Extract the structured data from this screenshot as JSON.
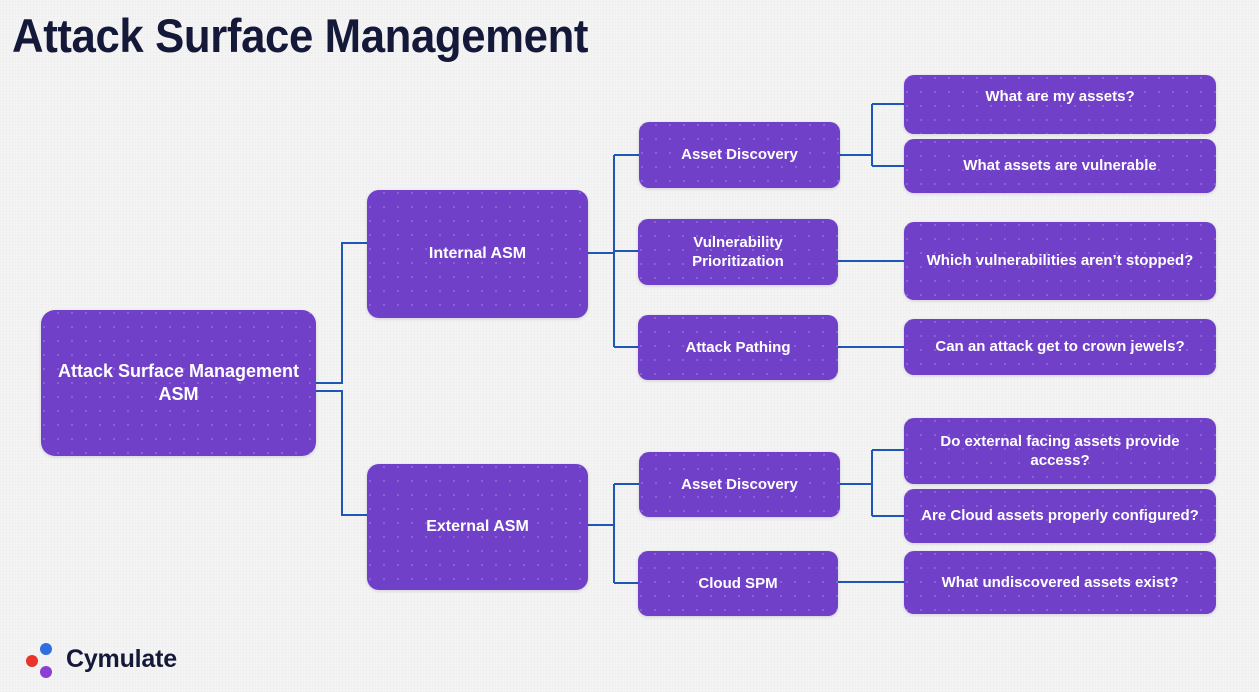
{
  "page": {
    "title": "Attack Surface Management",
    "background_color": "#f4f4f4",
    "node_color": "#7040c8",
    "node_text_color": "#ffffff",
    "connector_color": "#1f57b5",
    "title_color": "#151939"
  },
  "diagram": {
    "type": "tree",
    "root": {
      "label": "Attack Surface Management ASM"
    },
    "branches": [
      {
        "label": "Internal ASM",
        "children": [
          {
            "label": "Asset Discovery",
            "questions": [
              {
                "label": "What are my assets?"
              },
              {
                "label": "What assets are vulnerable"
              }
            ]
          },
          {
            "label": "Vulnerability Prioritization",
            "questions": [
              {
                "label": "Which vulnerabilities aren’t stopped?"
              }
            ]
          },
          {
            "label": "Attack Pathing",
            "questions": [
              {
                "label": "Can an attack get to crown jewels?"
              }
            ]
          }
        ]
      },
      {
        "label": "External ASM",
        "children": [
          {
            "label": "Asset Discovery",
            "questions": [
              {
                "label": "Do external facing assets provide access?"
              },
              {
                "label": "Are Cloud assets properly configured?"
              }
            ]
          },
          {
            "label": "Cloud SPM",
            "questions": [
              {
                "label": "What undiscovered assets exist?"
              }
            ]
          }
        ]
      }
    ]
  },
  "logo": {
    "brand": "Cymulate",
    "dot_colors": {
      "blue": "#2f6ee0",
      "red": "#e8342a",
      "purple": "#8b3fd4"
    }
  }
}
